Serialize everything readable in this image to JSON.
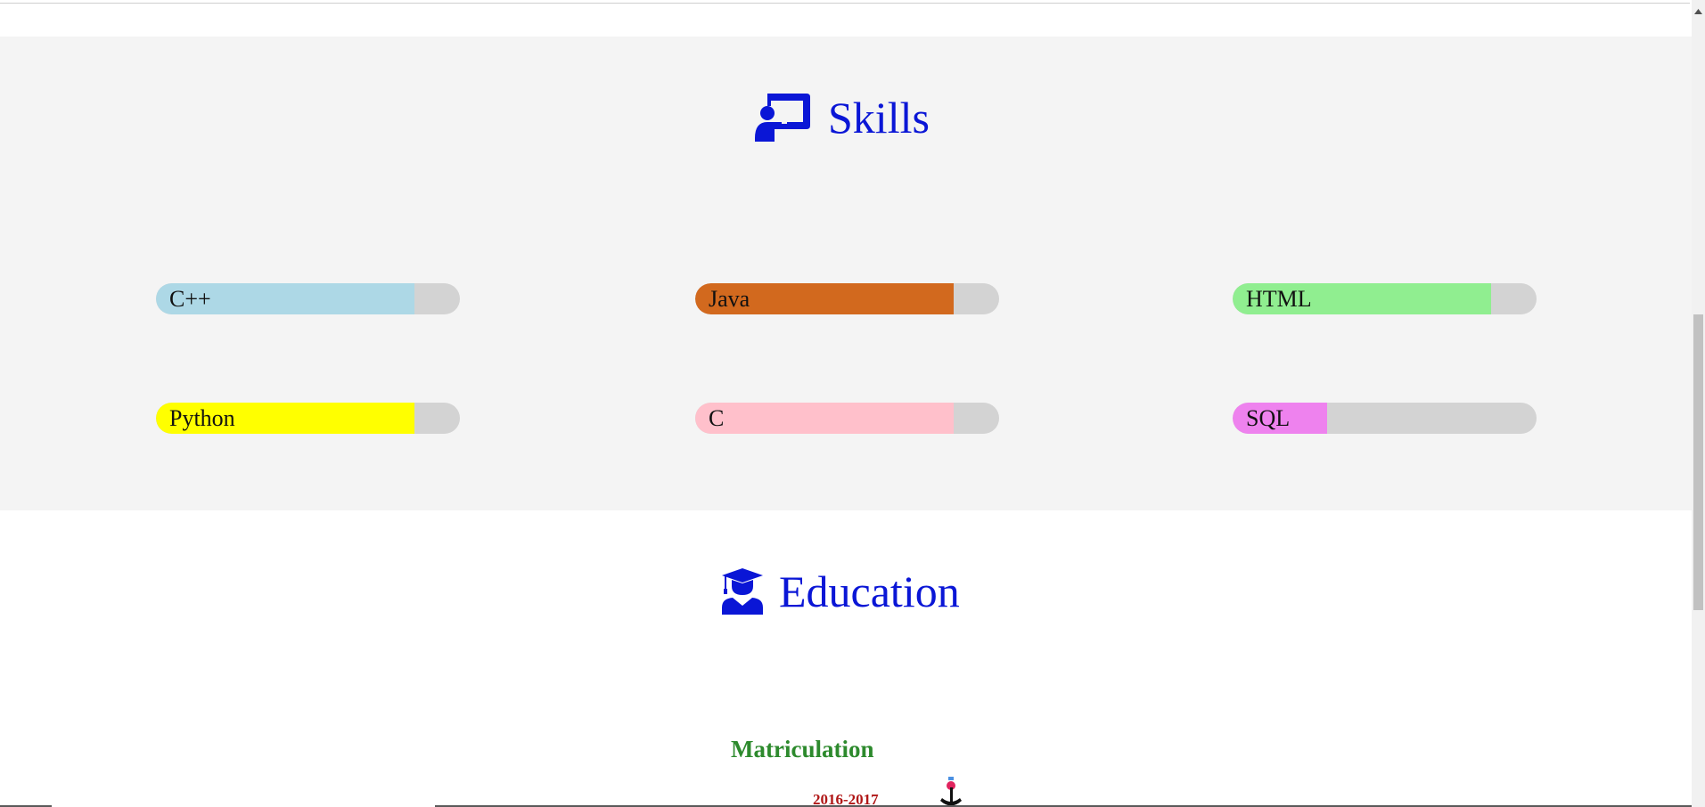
{
  "skills_section": {
    "title": "Skills",
    "icon": "chalkboard-teacher-icon",
    "heading_color": "#0a16d6",
    "background": "#f4f4f4",
    "track_color": "#d3d3d3",
    "items": [
      {
        "name": "C++",
        "level_percent": 85,
        "color": "#add8e6"
      },
      {
        "name": "Java",
        "level_percent": 85,
        "color": "#d2691e"
      },
      {
        "name": "HTML",
        "level_percent": 85,
        "color": "#90ee90"
      },
      {
        "name": "Python",
        "level_percent": 85,
        "color": "#ffff00"
      },
      {
        "name": "C",
        "level_percent": 85,
        "color": "#ffc0cb"
      },
      {
        "name": "SQL",
        "level_percent": 31,
        "color": "#ee82ee"
      }
    ]
  },
  "education_section": {
    "title": "Education",
    "icon": "user-graduate-icon",
    "heading_color": "#0a16d6",
    "entries": [
      {
        "title": "Matriculation",
        "years": "2016-2017",
        "title_color": "#2d8a2d",
        "years_color": "#b01717"
      }
    ]
  },
  "scrollbar": {
    "icon": "scroll-up-arrow-icon"
  }
}
